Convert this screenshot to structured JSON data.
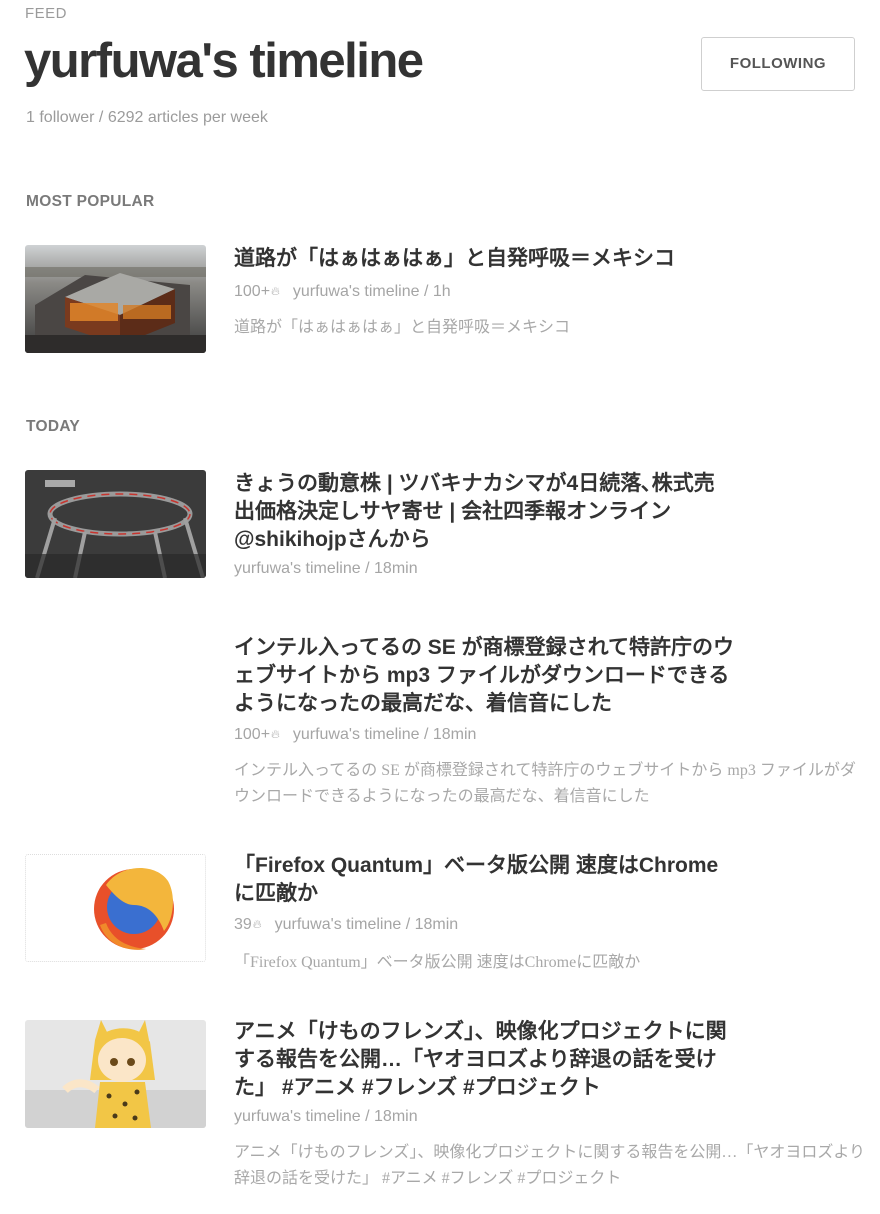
{
  "header": {
    "kicker": "FEED",
    "title": "yurfuwa's timeline",
    "follow_label": "FOLLOWING",
    "stats": "1 follower / 6292 articles per week"
  },
  "sections": {
    "popular": "MOST POPULAR",
    "today": "TODAY"
  },
  "icons": {
    "flame": "flame-icon"
  },
  "articles": [
    {
      "title": "道路が「はぁはぁはぁ」と自発呼吸＝メキシコ",
      "count": "100+",
      "source": "yurfuwa's timeline",
      "time": "1h",
      "sep": "/",
      "desc": "道路が「はぁはぁはぁ」と自発呼吸＝メキシコ",
      "thumbnail": "building-photo"
    },
    {
      "title": "きょうの動意株 | ツバキナカシマが4日続落､株式売出価格決定しサヤ寄せ | 会社四季報オンライン @shikihojpさんから",
      "source": "yurfuwa's timeline",
      "time": "18min",
      "sep": "/",
      "thumbnail": "chart-photo"
    },
    {
      "title": "インテル入ってるの SE が商標登録されて特許庁のウェブサイトから mp3 ファイルがダウンロードできるようになったの最高だな、着信音にした",
      "count": "100+",
      "source": "yurfuwa's timeline",
      "time": "18min",
      "sep": "/",
      "desc": "インテル入ってるの SE が商標登録されて特許庁のウェブサイトから mp3 ファイルがダウンロードできるようになったの最高だな、着信音にした"
    },
    {
      "title": "「Firefox Quantum」ベータ版公開 速度はChromeに匹敵か",
      "count": "39",
      "source": "yurfuwa's timeline",
      "time": "18min",
      "sep": "/",
      "desc": "「Firefox Quantum」ベータ版公開 速度はChromeに匹敵か",
      "thumbnail": "firefox-logo"
    },
    {
      "title": "アニメ「けものフレンズ」、映像化プロジェクトに関する報告を公開…「ヤオヨロズより辞退の話を受けた」 #アニメ #フレンズ #プロジェクト",
      "source": "yurfuwa's timeline",
      "time": "18min",
      "sep": "/",
      "desc": "アニメ「けものフレンズ」、映像化プロジェクトに関する報告を公開…「ヤオヨロズより辞退の話を受けた」 #アニメ #フレンズ #プロジェクト",
      "thumbnail": "anime-character"
    }
  ]
}
